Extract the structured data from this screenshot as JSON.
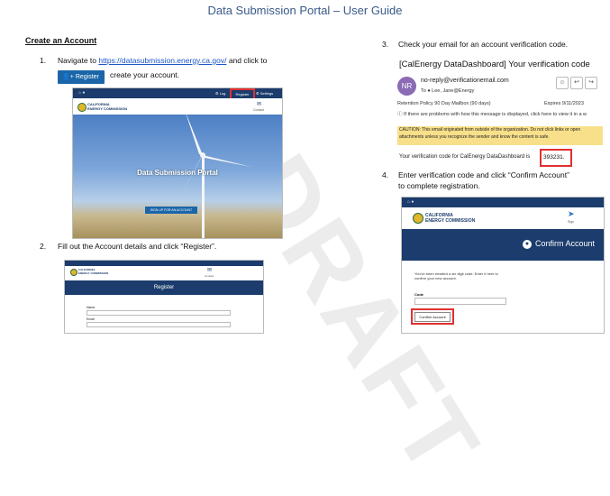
{
  "title": "Data Submission Portal – User Guide",
  "section_heading": "Create an Account",
  "steps": {
    "s1_prefix": "Navigate to",
    "s1_link": "https://datasubmission.energy.ca.gov/",
    "s1_suffix": "and click to",
    "s1_cont": "create your account.",
    "register_button": "Register",
    "s2": "Fill out the Account details and click “Register”.",
    "s3": "Check your email for an account verification code.",
    "s4a": "Enter verification code and click “Confirm Account”",
    "s4b": "to complete registration.",
    "n1": "1.",
    "n2": "2.",
    "n3": "3.",
    "n4": "4."
  },
  "portal_shot": {
    "nav_links": [
      "⚙ Log",
      "Register",
      "⚙ Settings"
    ],
    "logo_line1": "CALIFORNIA",
    "logo_line2": "ENERGY COMMISSION",
    "hero_title": "Data Submission Portal",
    "signup_label": "SIGN UP FOR AN ACCOUNT",
    "contact": "Contact"
  },
  "register_shot": {
    "logo_line1": "CALIFORNIA",
    "logo_line2": "ENERGY COMMISSION",
    "header": "Register",
    "field1": "Name",
    "field2": "Email",
    "icon_label": "Contact"
  },
  "email": {
    "subject": "[CalEnergy DataDashboard] Your verification code",
    "avatar": "NR",
    "from": "no-reply@verificationemail.com",
    "to": "To  ● Lee, Jane@Energy",
    "retention": "Retention Policy  90 Day Mailbox (90 days)",
    "expires": "Expires  9/11/2023",
    "problems": "ⓘ If there are problems with how this message is displayed, click here to view it in a w",
    "caution1": "CAUTION: This email originated from outside of the organization. Do not click links or open",
    "caution2": "attachments unless you recognize the sender and know the content is safe.",
    "code_prefix": "Your verification code for CalEnergy DataDashboard is",
    "code": "393231."
  },
  "confirm_shot": {
    "logo_line1": "CALIFORNIA",
    "logo_line2": "ENERGY COMMISSION",
    "confirm_header": "Confirm Account",
    "sent_line1": "You've been emailed a six digit code. Enter it here to",
    "sent_line2": "confirm your new account.",
    "code_label": "Code",
    "confirm_button": "Confirm Account",
    "nav_label": "Sign"
  },
  "watermark": "DRAFT"
}
